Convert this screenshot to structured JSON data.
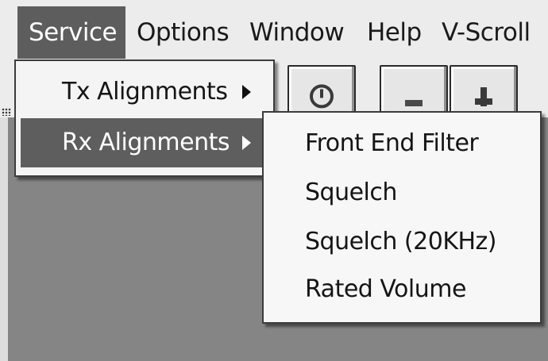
{
  "menubar": {
    "items": [
      "Service",
      "Options",
      "Window",
      "Help",
      "V-Scroll"
    ]
  },
  "toolbar": {
    "icons": [
      "alarm-icon",
      "minus-icon",
      "plus-icon"
    ]
  },
  "service_menu": {
    "items": [
      {
        "label": "Tx Alignments",
        "has_submenu": true
      },
      {
        "label": "Rx Alignments",
        "has_submenu": true,
        "highlighted": true
      }
    ]
  },
  "rx_submenu": {
    "items": [
      "Front End Filter",
      "Squelch",
      "Squelch (20KHz)",
      "Rated Volume"
    ]
  },
  "colors": {
    "menu_highlight": "#5e5e5e",
    "workspace": "#858585"
  }
}
